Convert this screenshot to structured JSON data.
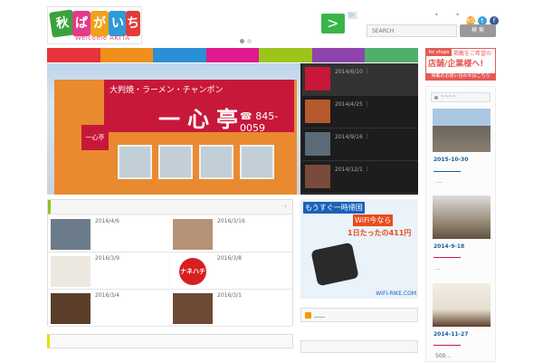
{
  "header": {
    "logo": {
      "chars": [
        "秋",
        "ぱ",
        "が",
        "い",
        "ち"
      ],
      "tagline": "Welcome AKITA",
      "badge": "ばん!"
    },
    "ad_arrow": ">",
    "ad_choice": "▷",
    "search_placeholder": "SEARCH",
    "search_button": "検 索",
    "social": [
      "RSS",
      "t",
      "f"
    ],
    "mini_dots": "• •"
  },
  "nav_colors": [
    "#e8333b",
    "#f08f1b",
    "#2a8fd6",
    "#e0198f",
    "#9dc41a",
    "#8e44ad",
    "#4fb06b"
  ],
  "slider": {
    "awning_small": "大判焼・ラーメン・チャンポン",
    "awning_big": "一心亭",
    "awning_phone": "☎ 845-0059",
    "side_sign": "一心亭",
    "items": [
      {
        "date": "2014/6/10  ｜",
        "mark": ".."
      },
      {
        "date": "2014/4/25  ｜",
        "mark": ". ."
      },
      {
        "date": "2014/9/16  ｜",
        "mark": "."
      },
      {
        "date": "2014/12/1  ｜",
        "mark": "."
      }
    ]
  },
  "articles": {
    "header_arrow": "›",
    "cells": [
      {
        "date": "2016/4/6"
      },
      {
        "date": "2016/3/16"
      },
      {
        "date": "2016/3/9"
      },
      {
        "date": "2016/3/8"
      },
      {
        "date": "2016/3/4"
      },
      {
        "date": "2016/3/1"
      }
    ],
    "badge_text": "ナネハチ"
  },
  "wifi_ad": {
    "line1": "もうすぐ一時帰国",
    "line2": "WiFi今なら",
    "line3": "1日たったの411円",
    "url": "WIFI-RIKE.COM"
  },
  "rss_box": {
    "text": "____"
  },
  "right": {
    "banner_tag": "for shops",
    "banner_line1": "掲載をご希望の",
    "banner_line2": "店舗/企業様へ!",
    "banner_line3": "掲載のお問い合わせはこちら",
    "side_head": "~~~~",
    "items": [
      {
        "date": "2015-10-30",
        "dots": "...."
      },
      {
        "date": "2014-9-18",
        "dots": "..."
      },
      {
        "date": "2014-11-27",
        "dots": "500..."
      }
    ]
  }
}
